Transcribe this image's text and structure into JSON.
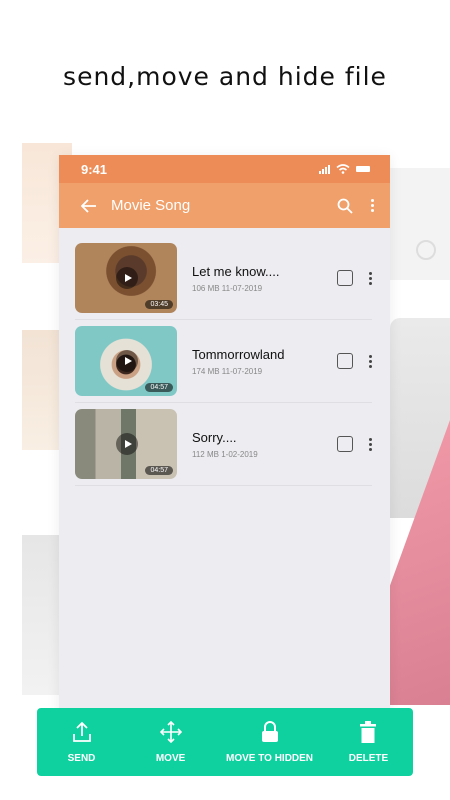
{
  "headline": "send,move and hide file",
  "status": {
    "time": "9:41"
  },
  "appbar": {
    "title": "Movie Song"
  },
  "files": [
    {
      "name": "Let me know....",
      "meta": "106 MB 11-07-2019",
      "duration": "03:45"
    },
    {
      "name": "Tommorrowland",
      "meta": "174 MB 11-07-2019",
      "duration": "04:57"
    },
    {
      "name": "Sorry....",
      "meta": "112 MB 1-02-2019",
      "duration": "04:57"
    }
  ],
  "actions": [
    {
      "label": "SEND",
      "icon": "upload-icon"
    },
    {
      "label": "MOVE",
      "icon": "move-icon"
    },
    {
      "label": "MOVE TO HIDDEN",
      "icon": "lock-icon"
    },
    {
      "label": "DELETE",
      "icon": "trash-icon"
    }
  ],
  "colors": {
    "statusbar": "#ee8c57",
    "appbar": "#f0a06b",
    "action_bar": "#0fd19f"
  }
}
